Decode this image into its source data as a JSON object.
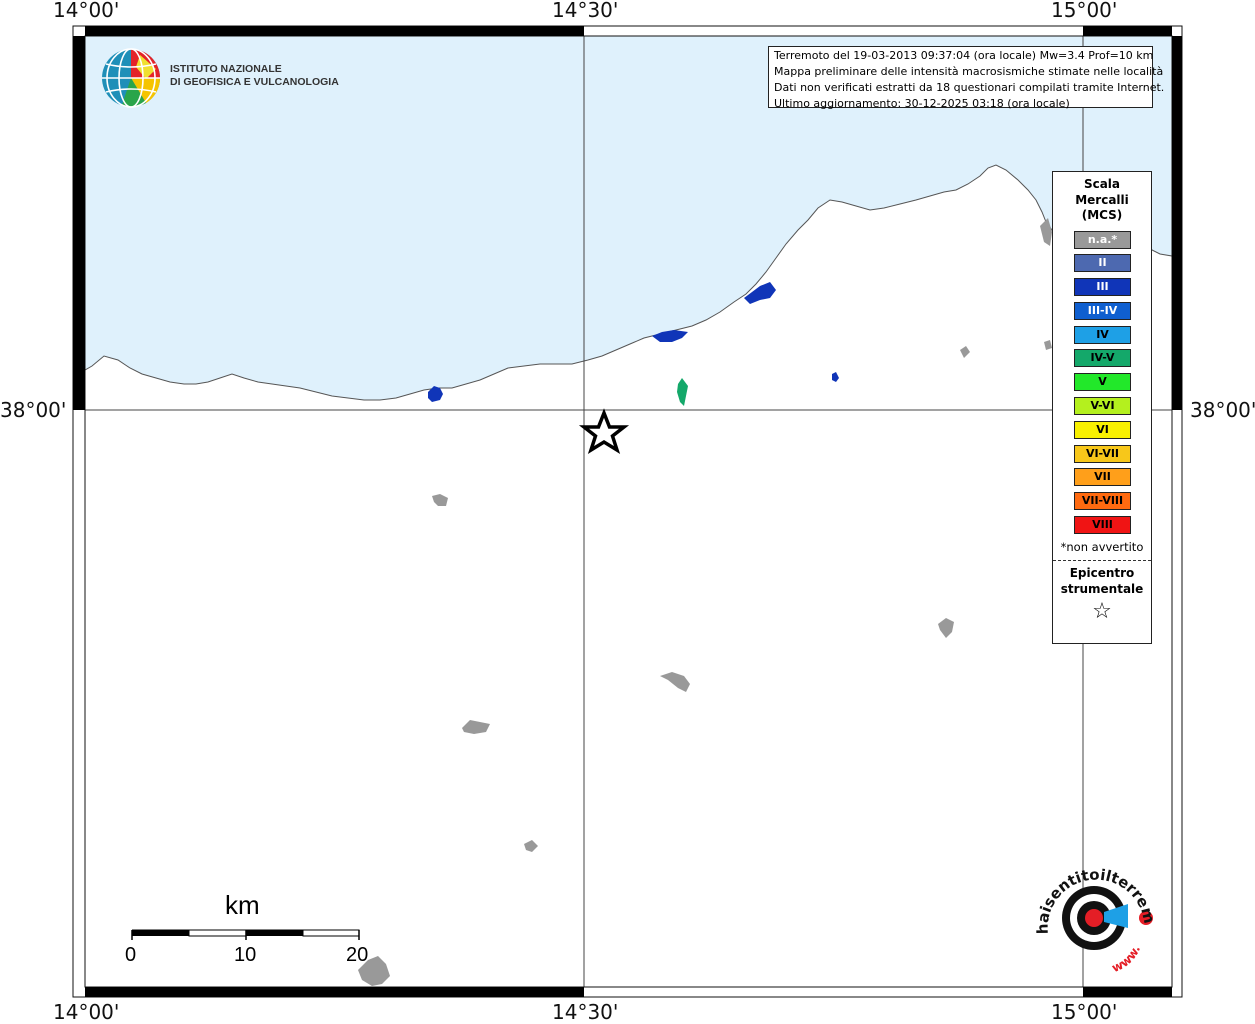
{
  "coordinates": {
    "top": [
      "14°00'",
      "14°30'",
      "15°00'"
    ],
    "bottom": [
      "14°00'",
      "14°30'",
      "15°00'"
    ],
    "left": [
      "38°00'"
    ],
    "right": [
      "38°00'"
    ]
  },
  "info": {
    "line1": "Terremoto del 19-03-2013 09:37:04 (ora locale) Mw=3.4 Prof=10 km",
    "line2": "Mappa preliminare delle intensità macrosismiche stimate nelle località",
    "line3": "Dati non verificati estratti da 18 questionari compilati tramite Internet.",
    "line4": "Ultimo aggiornamento: 30-12-2025 03:18 (ora locale)"
  },
  "logo": {
    "line1": "ISTITUTO NAZIONALE",
    "line2": "DI GEOFISICA E VULCANOLOGIA"
  },
  "legend": {
    "title1": "Scala",
    "title2": "Mercalli",
    "title3": "(MCS)",
    "classes": [
      {
        "label": "n.a.*",
        "color": "#999999",
        "text_color": "#ffffff"
      },
      {
        "label": "II",
        "color": "#4d69b0",
        "text_color": "#ffffff"
      },
      {
        "label": "III",
        "color": "#1035b8",
        "text_color": "#ffffff"
      },
      {
        "label": "III-IV",
        "color": "#0f5fd0",
        "text_color": "#ffffff"
      },
      {
        "label": "IV",
        "color": "#1ea0e6",
        "text_color": "#000000"
      },
      {
        "label": "IV-V",
        "color": "#14a86a",
        "text_color": "#000000"
      },
      {
        "label": "V",
        "color": "#22e82a",
        "text_color": "#000000"
      },
      {
        "label": "V-VI",
        "color": "#b4f01e",
        "text_color": "#000000"
      },
      {
        "label": "VI",
        "color": "#f8f000",
        "text_color": "#000000"
      },
      {
        "label": "VI-VII",
        "color": "#f7c71a",
        "text_color": "#000000"
      },
      {
        "label": "VII",
        "color": "#ff9f1a",
        "text_color": "#000000"
      },
      {
        "label": "VII-VIII",
        "color": "#ff6a10",
        "text_color": "#000000"
      },
      {
        "label": "VIII",
        "color": "#f01414",
        "text_color": "#000000"
      }
    ],
    "na_note": "*non avvertito",
    "epicentre1": "Epicentro",
    "epicentre2": "strumentale",
    "star": "☆"
  },
  "scalebar": {
    "unit": "km",
    "labels": [
      "0",
      "10",
      "20"
    ]
  },
  "colors": {
    "sea": "#dff1fc",
    "land": "#ffffff",
    "grid": "#555555",
    "na_locality": "#999999"
  },
  "badge": {
    "text_top": "haisentitoilterremoto.it",
    "text_bottom": "www."
  }
}
